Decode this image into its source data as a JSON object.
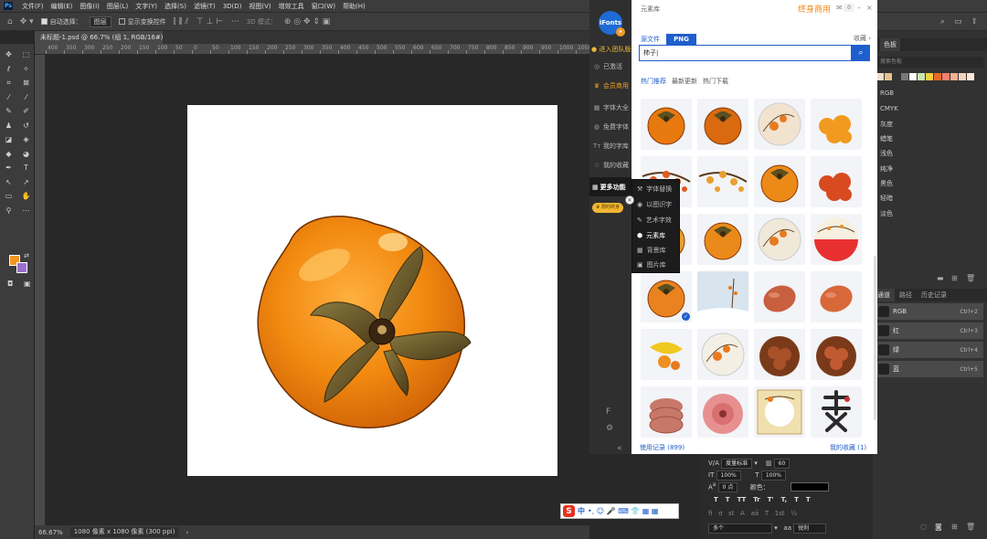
{
  "menubar": {
    "items": [
      "文件(F)",
      "编辑(E)",
      "图像(I)",
      "图层(L)",
      "文字(Y)",
      "选择(S)",
      "滤镜(T)",
      "3D(D)",
      "视图(V)",
      "增效工具",
      "窗口(W)",
      "帮助(H)"
    ],
    "logo": "Ps"
  },
  "optbar": {
    "auto_select": "自动选择：",
    "layer_select": "图层",
    "show_transform": "显示变换控件",
    "mode_label": "3D 模式："
  },
  "document": {
    "tab_title": "未标题-1.psd @ 66.7% (组 1, RGB/16#) *",
    "tab_close": "×",
    "zoom": "66.67%",
    "doc_info": "1080 像素 x 1080 像素 (300 ppi)"
  },
  "ruler": {
    "h_labels": [
      "400",
      "350",
      "300",
      "250",
      "200",
      "150",
      "100",
      "50",
      "0",
      "50",
      "100",
      "150",
      "200",
      "250",
      "300",
      "350",
      "400",
      "450",
      "500",
      "550",
      "600",
      "650",
      "700",
      "750",
      "800",
      "850",
      "900",
      "950",
      "1000",
      "1050",
      "1100",
      "1150",
      "1200",
      "1250",
      "1300",
      "1350",
      "1400",
      "1450"
    ]
  },
  "ime": {
    "label": "中",
    "icons": "•, ☺ 🎤 ⌨ 👕 ▦ ▦"
  },
  "plugin": {
    "title": "元素库",
    "vip_title": "终身商用",
    "notif_count": "0",
    "logo_text": "iFonts",
    "sidebar": {
      "enter_team": "进入团队版",
      "activated": "已激活",
      "member_commercial": "会员商用",
      "font_encyclopedia": "字体大全",
      "free_fonts": "免费字体",
      "my_fonts": "我的字库",
      "my_favorites": "我的收藏",
      "more_features": "更多功能",
      "limited_offer": "限时终身"
    },
    "submenu": {
      "font_replace": "字体替换",
      "image_to_font": "以图识字",
      "art_text": "艺术字效",
      "element_lib": "元素库",
      "background_lib": "背景库",
      "image_lib": "图片库"
    },
    "tabs": {
      "source": "源文件",
      "png": "PNG"
    },
    "favorites": "收藏",
    "search_value": "柿子|",
    "filters": [
      "热门推荐",
      "最新更新",
      "热门下载"
    ],
    "footer_left": "使用记录 (899)",
    "footer_right": "我的收藏 (1)"
  },
  "right_panel": {
    "swatch_tab": "色板",
    "search_placeholder": "搜索色板",
    "swatch_colors": [
      "#f0e0c8",
      "#e8c090",
      "#333333",
      "#777777",
      "#ffffff",
      "#c8e6b0",
      "#f5d040",
      "#e66a2a",
      "#f08070",
      "#f4b090",
      "#f8d4c0",
      "#ffe8d8"
    ],
    "swatch_groups": [
      "RGB",
      "CMYK",
      "灰度",
      "蜡笔",
      "浅色",
      "纯净",
      "黑色",
      "轻暗",
      "淡色"
    ],
    "layer_tabs": [
      "通道",
      "路径",
      "历史记录"
    ],
    "channels": [
      {
        "name": "RGB",
        "shortcut": "Ctrl+2"
      },
      {
        "name": "红",
        "shortcut": "Ctrl+3"
      },
      {
        "name": "绿",
        "shortcut": "Ctrl+4"
      },
      {
        "name": "蓝",
        "shortcut": "Ctrl+5"
      }
    ]
  },
  "char_panel": {
    "tracking_mode": "度量标准",
    "tracking_value": "60",
    "scale_v": "100%",
    "scale_h": "100%",
    "baseline": "0 点",
    "color_label": "颜色：",
    "lang": "多个",
    "aa": "锐利",
    "format_buttons": [
      "T",
      "T",
      "TT",
      "Tr",
      "T'",
      "T,",
      "T",
      "T"
    ]
  }
}
